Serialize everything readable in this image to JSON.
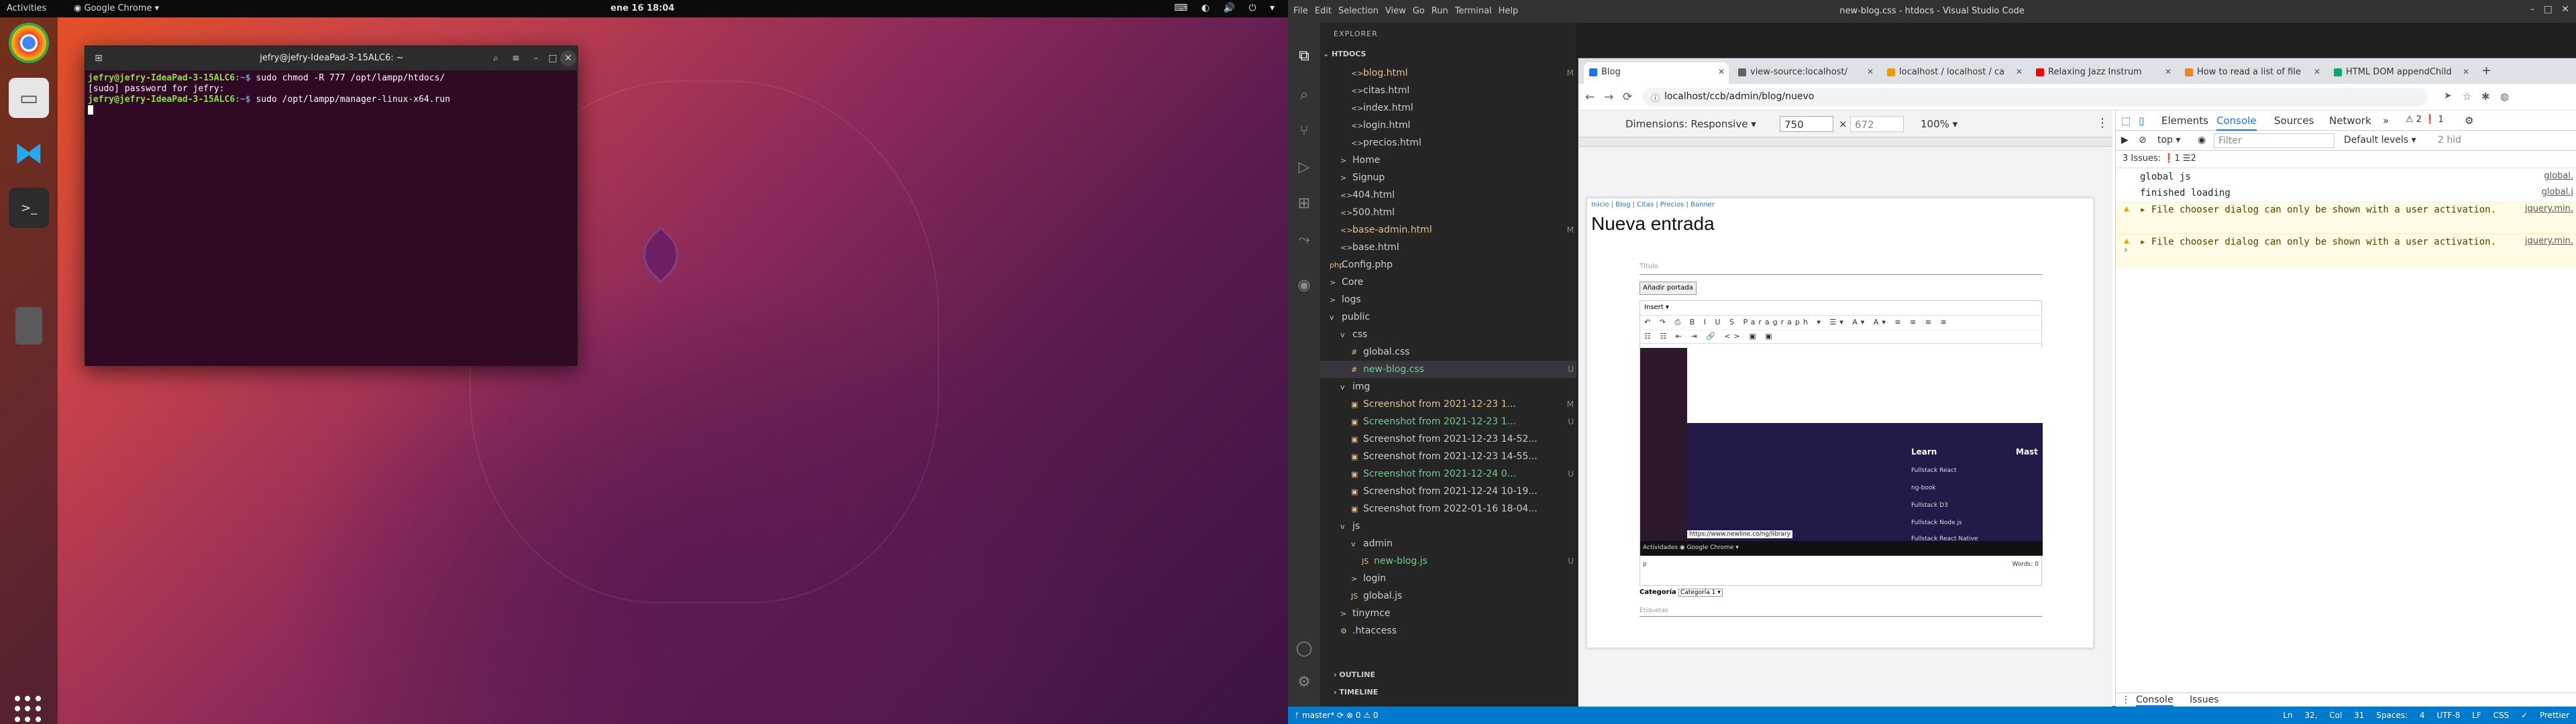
{
  "desktop": {
    "activities": "Activities",
    "active_app": "Google Chrome",
    "clock": "ene 16  18:04",
    "dock": [
      "chrome-icon",
      "files-icon",
      "vscode-icon",
      "terminal-icon",
      "trash-icon"
    ]
  },
  "terminal": {
    "title": "jefry@jefry-IdeaPad-3-15ALC6: ~",
    "lines": [
      {
        "prompt": "jefry@jefry-IdeaPad-3-15ALC6",
        "path": ":~$",
        "cmd": " sudo chmod -R 777 /opt/lampp/htdocs/"
      },
      {
        "text": "[sudo] password for jefry:"
      },
      {
        "prompt": "jefry@jefry-IdeaPad-3-15ALC6",
        "path": ":~$",
        "cmd": " sudo /opt/lampp/manager-linux-x64.run"
      }
    ]
  },
  "vscode": {
    "window_title": "new-blog.css - htdocs - Visual Studio Code",
    "menu": [
      "File",
      "Edit",
      "Selection",
      "View",
      "Go",
      "Run",
      "Terminal",
      "Help"
    ],
    "explorer_label": "EXPLORER",
    "root": "HTDOCS",
    "tree": [
      {
        "name": "blog.html",
        "indent": 2,
        "status": "M",
        "cls": "git-m",
        "icon": "<>"
      },
      {
        "name": "citas.html",
        "indent": 2,
        "status": "",
        "cls": "",
        "icon": "<>"
      },
      {
        "name": "index.html",
        "indent": 2,
        "status": "",
        "cls": "",
        "icon": "<>"
      },
      {
        "name": "login.html",
        "indent": 2,
        "status": "",
        "cls": "",
        "icon": "<>"
      },
      {
        "name": "precios.html",
        "indent": 2,
        "status": "",
        "cls": "",
        "icon": "<>"
      },
      {
        "name": "Home",
        "indent": 1,
        "status": "",
        "cls": "",
        "icon": ">"
      },
      {
        "name": "Signup",
        "indent": 1,
        "status": "",
        "cls": "",
        "icon": ">"
      },
      {
        "name": "404.html",
        "indent": 1,
        "status": "",
        "cls": "",
        "icon": "<>"
      },
      {
        "name": "500.html",
        "indent": 1,
        "status": "",
        "cls": "",
        "icon": "<>"
      },
      {
        "name": "base-admin.html",
        "indent": 1,
        "status": "M",
        "cls": "git-m",
        "icon": "<>"
      },
      {
        "name": "base.html",
        "indent": 1,
        "status": "",
        "cls": "",
        "icon": "<>"
      },
      {
        "name": "Config.php",
        "indent": 0,
        "status": "",
        "cls": "",
        "icon": "php"
      },
      {
        "name": "Core",
        "indent": 0,
        "status": "",
        "cls": "",
        "icon": ">"
      },
      {
        "name": "logs",
        "indent": 0,
        "status": "",
        "cls": "",
        "icon": ">"
      },
      {
        "name": "public",
        "indent": 0,
        "status": "",
        "cls": "",
        "icon": "v"
      },
      {
        "name": "css",
        "indent": 1,
        "status": "",
        "cls": "",
        "icon": "v"
      },
      {
        "name": "global.css",
        "indent": 2,
        "status": "",
        "cls": "",
        "icon": "#"
      },
      {
        "name": "new-blog.css",
        "indent": 2,
        "status": "U",
        "cls": "git-u",
        "icon": "#"
      },
      {
        "name": "img",
        "indent": 1,
        "status": "",
        "cls": "",
        "icon": "v"
      },
      {
        "name": "Screenshot from 2021-12-23 1...",
        "indent": 2,
        "status": "M",
        "cls": "git-m",
        "icon": "▣"
      },
      {
        "name": "Screenshot from 2021-12-23 1...",
        "indent": 2,
        "status": "U",
        "cls": "git-u",
        "icon": "▣"
      },
      {
        "name": "Screenshot from 2021-12-23 14-52...",
        "indent": 2,
        "status": "",
        "cls": "",
        "icon": "▣"
      },
      {
        "name": "Screenshot from 2021-12-23 14-55...",
        "indent": 2,
        "status": "",
        "cls": "",
        "icon": "▣"
      },
      {
        "name": "Screenshot from 2021-12-24 0...",
        "indent": 2,
        "status": "U",
        "cls": "git-u",
        "icon": "▣"
      },
      {
        "name": "Screenshot from 2021-12-24 10-19...",
        "indent": 2,
        "status": "",
        "cls": "",
        "icon": "▣"
      },
      {
        "name": "Screenshot from 2022-01-16 18-04...",
        "indent": 2,
        "status": "",
        "cls": "",
        "icon": "▣"
      },
      {
        "name": "js",
        "indent": 1,
        "status": "",
        "cls": "",
        "icon": "v"
      },
      {
        "name": "admin",
        "indent": 2,
        "status": "",
        "cls": "",
        "icon": "v"
      },
      {
        "name": "new-blog.js",
        "indent": 3,
        "status": "U",
        "cls": "git-u",
        "icon": "JS"
      },
      {
        "name": "login",
        "indent": 2,
        "status": "",
        "cls": "",
        "icon": ">"
      },
      {
        "name": "global.js",
        "indent": 2,
        "status": "",
        "cls": "",
        "icon": "JS"
      },
      {
        "name": "tinymce",
        "indent": 1,
        "status": "",
        "cls": "",
        "icon": ">"
      },
      {
        "name": ".htaccess",
        "indent": 1,
        "status": "",
        "cls": "",
        "icon": "⚙"
      }
    ],
    "outline": "OUTLINE",
    "timeline": "TIMELINE",
    "status_left": "ᚠ master*   ⟳   ⊗ 0 ⚠ 0",
    "status_right": "Ln 32, Col 31  Spaces: 4  UTF-8  LF  CSS  ✓ Prettier"
  },
  "chrome": {
    "tabs": [
      {
        "title": "Blog",
        "color": "#1a73e8",
        "active": true
      },
      {
        "title": "view-source:localhost/",
        "color": "#5f6368",
        "active": false
      },
      {
        "title": "localhost / localhost / ca",
        "color": "#f29900",
        "active": false
      },
      {
        "title": "Relaxing Jazz Instrum",
        "color": "#ff0000",
        "active": false
      },
      {
        "title": "How to read a list of file",
        "color": "#f48024",
        "active": false
      },
      {
        "title": "HTML DOM appendChild",
        "color": "#04aa6d",
        "active": false
      }
    ],
    "url": "localhost/ccb/admin/blog/nuevo",
    "device": {
      "dimensions": "Dimensions: Responsive ▾",
      "width": "750",
      "height": "672",
      "zoom": "100% ▾"
    },
    "page": {
      "breadcrumbs": "Inicio | Blog | Citas | Precios | Banner",
      "heading": "Nueva entrada",
      "titulo_placeholder": "Título",
      "portada_button": "Añadir portada",
      "editor_menu": "Insert ▾",
      "editor_tb1": "↶ ↷ ⎙ B I U S  Paragraph ▾  ☰▾  A▾ A▾  ≡ ≡ ≡ ≡",
      "editor_tb2": "☷ ☷ ⇤ ⇥ 🔗 <> ▣ ▣",
      "shot_learn": "Learn",
      "shot_mast": "Mast",
      "shot_items": [
        "Fullstack React",
        "ng-book",
        "Fullstack D3",
        "Fullstack Node.js",
        "Fullstack React Native"
      ],
      "shot_url": "https://www.newline.co/ng/library",
      "shot_bar": "Actividades      ◉ Google Chrome ▾",
      "editor_path": "p",
      "words": "Words: 0",
      "categoria_label": "Categoría",
      "categoria_value": "Categoría 1 ▾",
      "etiquetas_placeholder": "Etiquetas"
    },
    "devtools": {
      "tabs": [
        "Elements",
        "Console",
        "Sources",
        "Network"
      ],
      "active_tab": "Console",
      "badges": "⚠ 2   ❗ 1",
      "context": "top ▾",
      "filter_placeholder": "Filter",
      "levels": "Default levels ▾",
      "hidden": "2 hid",
      "issues": "3 Issues:  ❗1  ☰2",
      "messages": [
        {
          "text": "global js",
          "src": "global.",
          "warn": false
        },
        {
          "text": "finished loading",
          "src": "global.j",
          "warn": false
        },
        {
          "text": "▸ File chooser dialog can only be shown with a user activation.",
          "src": "jquery.min.",
          "warn": true
        },
        {
          "text": "▸ File chooser dialog can only be shown with a user activation.",
          "src": "jquery.min.",
          "warn": true
        }
      ],
      "drawer_tabs": [
        "Console",
        "Issues"
      ]
    }
  }
}
